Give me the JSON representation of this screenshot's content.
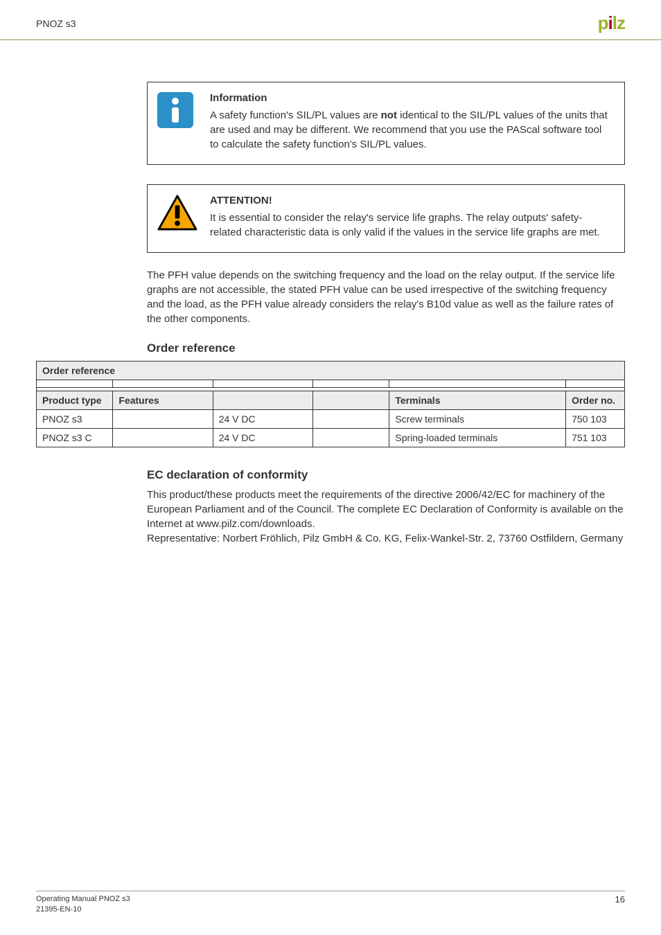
{
  "header": {
    "title": "PNOZ s3",
    "logo_text": "pilz"
  },
  "box_info": {
    "heading": "Information",
    "body": "A safety function's SIL/PL values are <b>not</b> identical to the SIL/PL values of the units that are used and may be different. We recommend that you use the PAScal software tool to calculate the safety function's SIL/PL values."
  },
  "box_attention": {
    "heading": "ATTENTION!",
    "body": "It is essential to consider the relay's service life graphs. The relay outputs' safety-related characteristic data is only valid if the values in the service life graphs are met."
  },
  "paragraph_pfh": "The PFH value depends on the switching frequency and the load on the relay output. If the service life graphs are not accessible, the stated PFH value can be used irrespective of the switching frequency and the load, as the PFH value already considers the relay's B10d value as well as the failure rates of the other components.",
  "order_ref": {
    "section_heading": "Order reference",
    "table_title": "Order reference",
    "headers": {
      "product_type": "Product type",
      "features": "Features",
      "terminals": "Terminals",
      "order_no": "Order no."
    },
    "rows": [
      {
        "product_type": "PNOZ s3",
        "features": "",
        "voltage": "24 V DC",
        "blank": "",
        "terminals": "Screw terminals",
        "order_no": "750 103"
      },
      {
        "product_type": "PNOZ s3 C",
        "features": "",
        "voltage": "24 V DC",
        "blank": "",
        "terminals": "Spring-loaded terminals",
        "order_no": "751 103"
      }
    ]
  },
  "ec": {
    "heading": "EC declaration of conformity",
    "body": "This product/these products meet the requirements of the directive 2006/42/EC for machinery of the European Parliament and of the Council. The complete EC Declaration of Conformity is available on the Internet at www.pilz.com/downloads.<br>Representative: Norbert Fröhlich, Pilz GmbH & Co. KG, Felix-Wankel-Str. 2, 73760 Ostfildern, Germany"
  },
  "footer": {
    "line1": "Operating Manual PNOZ s3",
    "line2": "21395-EN-10",
    "page": "16"
  }
}
